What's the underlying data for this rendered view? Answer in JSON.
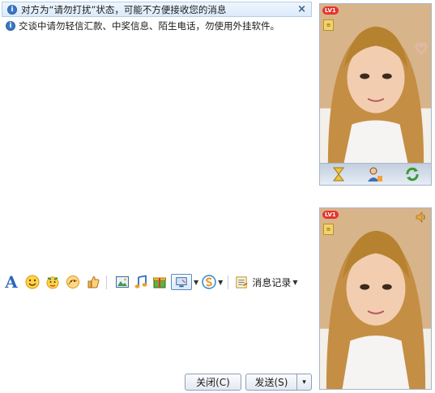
{
  "notice": {
    "text": "对方为“请勿打扰”状态，可能不方便接收您的消息",
    "close_glyph": "×",
    "icon": "info-icon"
  },
  "security_tip": {
    "text": "交谈中请勿轻信汇款、中奖信息、陌生电话，勿使用外挂软件。",
    "icon": "info-icon"
  },
  "toolbar": {
    "font_glyph": "A",
    "history_label": "消息记录",
    "icons": [
      "font-icon",
      "emoticon-icon",
      "magic-emoticon-icon",
      "scribble-icon",
      "thumb-icon",
      "image-icon",
      "music-icon",
      "gift-icon",
      "screenshot-icon",
      "soso-icon",
      "history-icon"
    ]
  },
  "buttons": {
    "close_label": "关闭(C)",
    "send_label": "发送(S)",
    "send_arrow": "▾"
  },
  "video_remote": {
    "level_badge": "LV1",
    "icons": [
      "level-badge-icon",
      "mini-badge-icon",
      "heart-icon"
    ]
  },
  "video_controls": {
    "icons": [
      "hourglass-icon",
      "user-assist-icon",
      "refresh-icon"
    ]
  },
  "video_local": {
    "level_badge": "LV1",
    "icons": [
      "level-badge-icon",
      "mini-badge-icon",
      "speaker-icon"
    ]
  },
  "colors": {
    "accent": "#2d68b8",
    "notice_bg": "#dbeafa",
    "level_badge": "#e4342d"
  }
}
